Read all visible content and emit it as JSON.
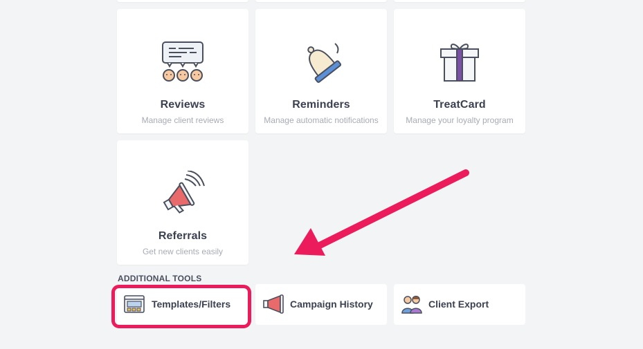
{
  "feature_cards": [
    {
      "title": "Reviews",
      "subtitle": "Manage client reviews",
      "icon": "reviews-speech-bubble-icon"
    },
    {
      "title": "Reminders",
      "subtitle": "Manage automatic notifications",
      "icon": "bell-icon"
    },
    {
      "title": "TreatCard",
      "subtitle": "Manage your loyalty program",
      "icon": "gift-box-icon"
    },
    {
      "title": "Referrals",
      "subtitle": "Get new clients easily",
      "icon": "megaphone-icon"
    }
  ],
  "additional_tools": {
    "label": "ADDITIONAL TOOLS",
    "items": [
      {
        "label": "Templates/Filters",
        "icon": "template-window-icon"
      },
      {
        "label": "Campaign History",
        "icon": "megaphone-icon"
      },
      {
        "label": "Client Export",
        "icon": "people-icon"
      }
    ]
  },
  "colors": {
    "highlight": "#ec1c5c",
    "background": "#f3f4f6",
    "card": "#ffffff",
    "text": "#3c4152",
    "subtext": "#a7abb6"
  }
}
